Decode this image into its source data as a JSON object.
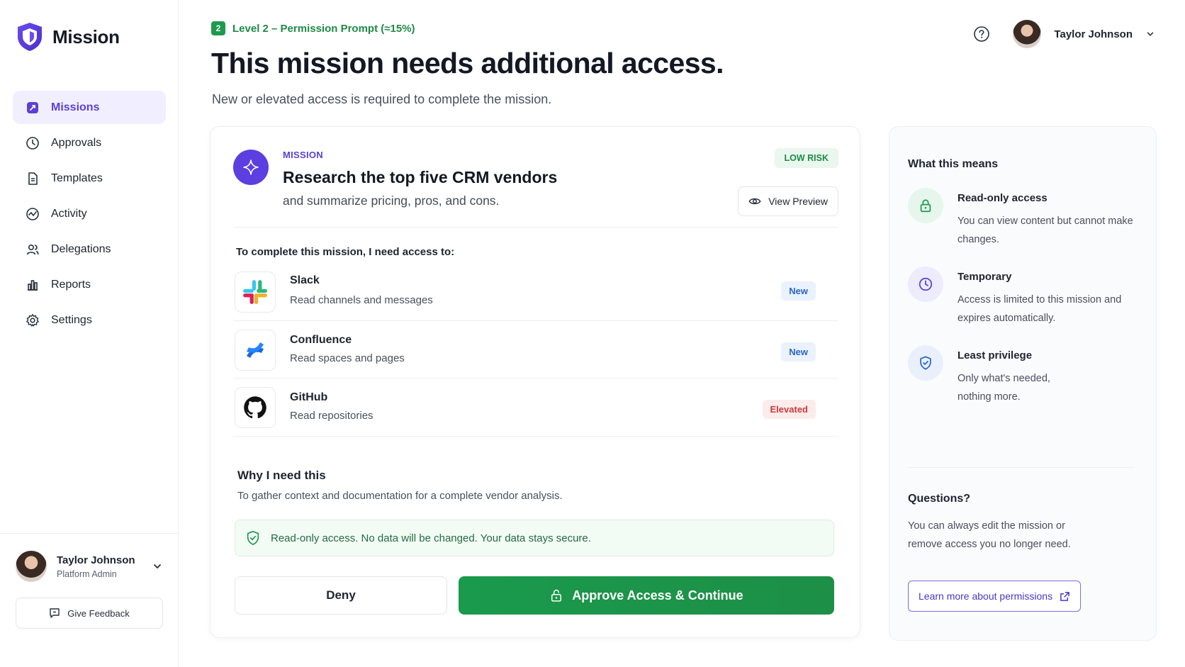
{
  "app": {
    "name": "Mission"
  },
  "sidebar": {
    "items": [
      {
        "label": "Missions",
        "icon": "missions-icon",
        "active": true
      },
      {
        "label": "Approvals",
        "icon": "clock-icon"
      },
      {
        "label": "Templates",
        "icon": "document-icon"
      },
      {
        "label": "Activity",
        "icon": "activity-icon"
      },
      {
        "label": "Delegations",
        "icon": "users-icon"
      },
      {
        "label": "Reports",
        "icon": "bar-chart-icon"
      },
      {
        "label": "Settings",
        "icon": "gear-icon"
      }
    ],
    "user": {
      "name": "Taylor Johnson",
      "role": "Platform Admin"
    },
    "feedback_label": "Give Feedback"
  },
  "header": {
    "level_number": "2",
    "level_text": "Level 2 – Permission Prompt (≈15%)",
    "title": "This mission needs additional access.",
    "subtitle": "New or elevated access is required to complete the mission.",
    "user_name": "Taylor Johnson"
  },
  "mission": {
    "eyebrow": "MISSION",
    "title": "Research the top five CRM vendors",
    "description": "and summarize pricing, pros, and cons.",
    "risk": "LOW RISK",
    "preview_label": "View Preview"
  },
  "access": {
    "heading": "To complete this mission, I need access to:",
    "items": [
      {
        "app": "Slack",
        "permission": "Read channels and messages",
        "tag": "New",
        "tag_type": "new"
      },
      {
        "app": "Confluence",
        "permission": "Read spaces and pages",
        "tag": "New",
        "tag_type": "new"
      },
      {
        "app": "GitHub",
        "permission": "Read repositories",
        "tag": "Elevated",
        "tag_type": "elevated"
      }
    ]
  },
  "why": {
    "title": "Why I need this",
    "text": "To gather context and documentation for a complete vendor analysis."
  },
  "secure_note": "Read-only access. No data will be changed. Your data stays secure.",
  "actions": {
    "deny": "Deny",
    "approve": "Approve Access & Continue"
  },
  "panel": {
    "title": "What this means",
    "items": [
      {
        "title": "Read-only access",
        "text": "You can view content but cannot make changes.",
        "icon": "lock-icon"
      },
      {
        "title": "Temporary",
        "text": "Access is limited to this mission and expires automatically.",
        "icon": "clock-icon"
      },
      {
        "title": "Least privilege",
        "text": "Only what's needed, nothing more.",
        "icon": "shield-check-icon"
      }
    ],
    "questions_title": "Questions?",
    "questions_text": "You can always edit the mission or remove access you no longer need.",
    "learn_more": "Learn more about permissions"
  },
  "colors": {
    "accent": "#5b3fd6",
    "success": "#1e9a4d",
    "danger": "#c93b3b",
    "info": "#2a66c7"
  }
}
